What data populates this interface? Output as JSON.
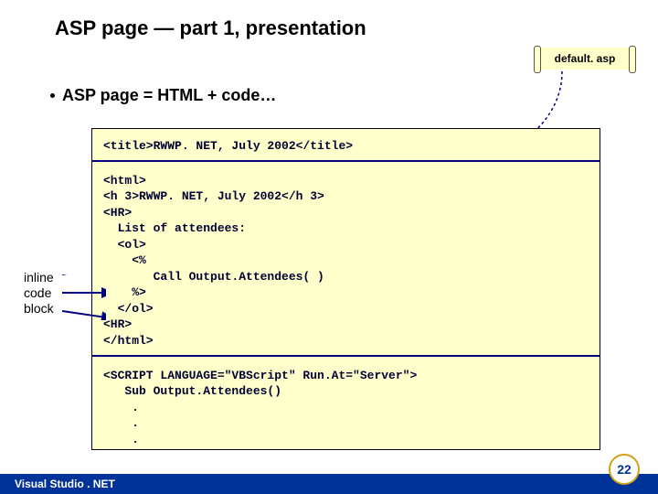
{
  "title": "ASP page — part 1, presentation",
  "scroll_label": "default. asp",
  "bullet": "ASP page = HTML + code…",
  "annotation": {
    "l1": "inline",
    "l2": "code",
    "l3": "block"
  },
  "code": {
    "seg1": "<title>RWWP. NET, July 2002</title>",
    "seg2": "<html>\n<h 3>RWWP. NET, July 2002</h 3>\n<HR>\n  List of attendees:\n  <ol>\n    <%\n       Call Output.Attendees( )\n    %>\n  </ol>\n<HR>\n</html>",
    "seg3": "<SCRIPT LANGUAGE=\"VBScript\" Run.At=\"Server\">\n   Sub Output.Attendees()\n    .\n    .\n    ."
  },
  "footer": "Visual Studio . NET",
  "page_number": "22"
}
